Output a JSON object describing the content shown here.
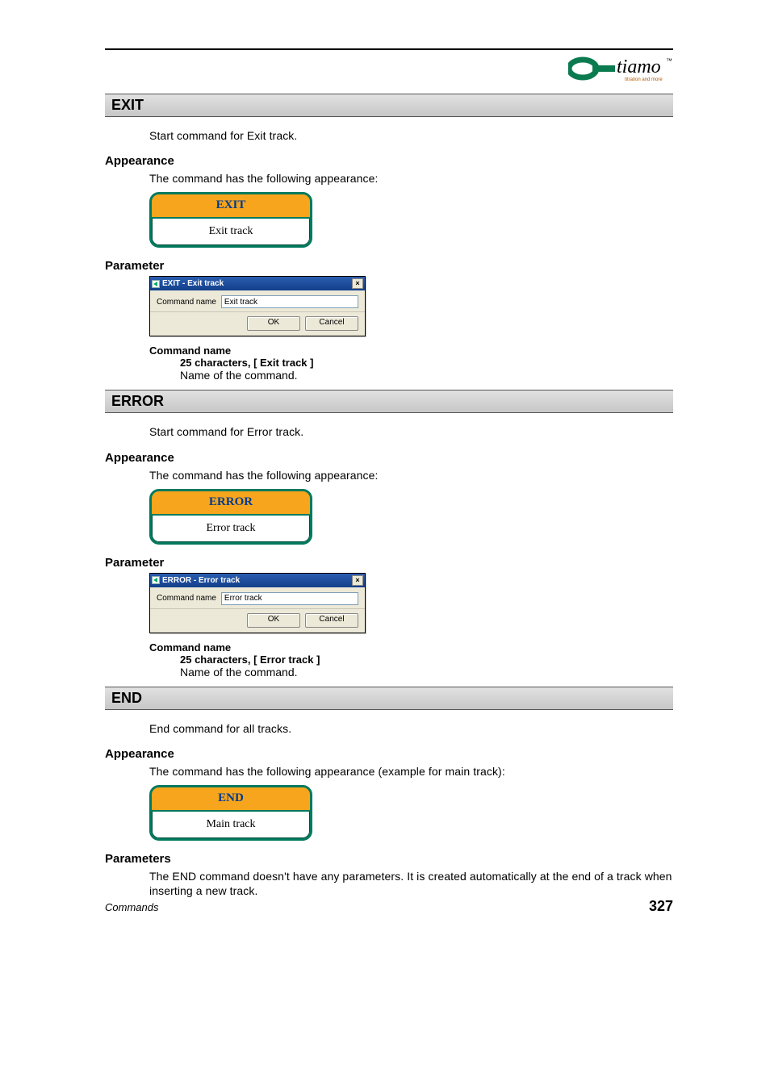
{
  "logo": {
    "brand": "tiamo",
    "tm": "™",
    "tagline": "titration and more"
  },
  "sections": {
    "exit": {
      "title": "EXIT",
      "intro": "Start command for Exit track.",
      "appearance_hd": "Appearance",
      "appearance_txt": "The command has the following appearance:",
      "widget_head": "EXIT",
      "widget_body": "Exit track",
      "parameter_hd": "Parameter",
      "dlg_title": "EXIT - Exit track",
      "dlg_label": "Command name",
      "dlg_value": "Exit track",
      "dlg_ok": "OK",
      "dlg_cancel": "Cancel",
      "pname": "Command name",
      "pspec": "25 characters, [ Exit track ]",
      "pdesc": "Name of the command."
    },
    "error": {
      "title": "ERROR",
      "intro": "Start command for Error track.",
      "appearance_hd": "Appearance",
      "appearance_txt": "The command has the following appearance:",
      "widget_head": "ERROR",
      "widget_body": "Error track",
      "parameter_hd": "Parameter",
      "dlg_title": "ERROR - Error track",
      "dlg_label": "Command name",
      "dlg_value": "Error track",
      "dlg_ok": "OK",
      "dlg_cancel": "Cancel",
      "pname": "Command name",
      "pspec": "25 characters, [ Error track ]",
      "pdesc": "Name of the command."
    },
    "end": {
      "title": "END",
      "intro": "End command for all tracks.",
      "appearance_hd": "Appearance",
      "appearance_txt": "The command has the following appearance (example for main track):",
      "widget_head": "END",
      "widget_body": "Main track",
      "parameters_hd": "Parameters",
      "ptxt": "The END command doesn't have any parameters. It is created automatically at the end of a track when inserting a new track."
    }
  },
  "footer": {
    "left": "Commands",
    "right": "327"
  }
}
